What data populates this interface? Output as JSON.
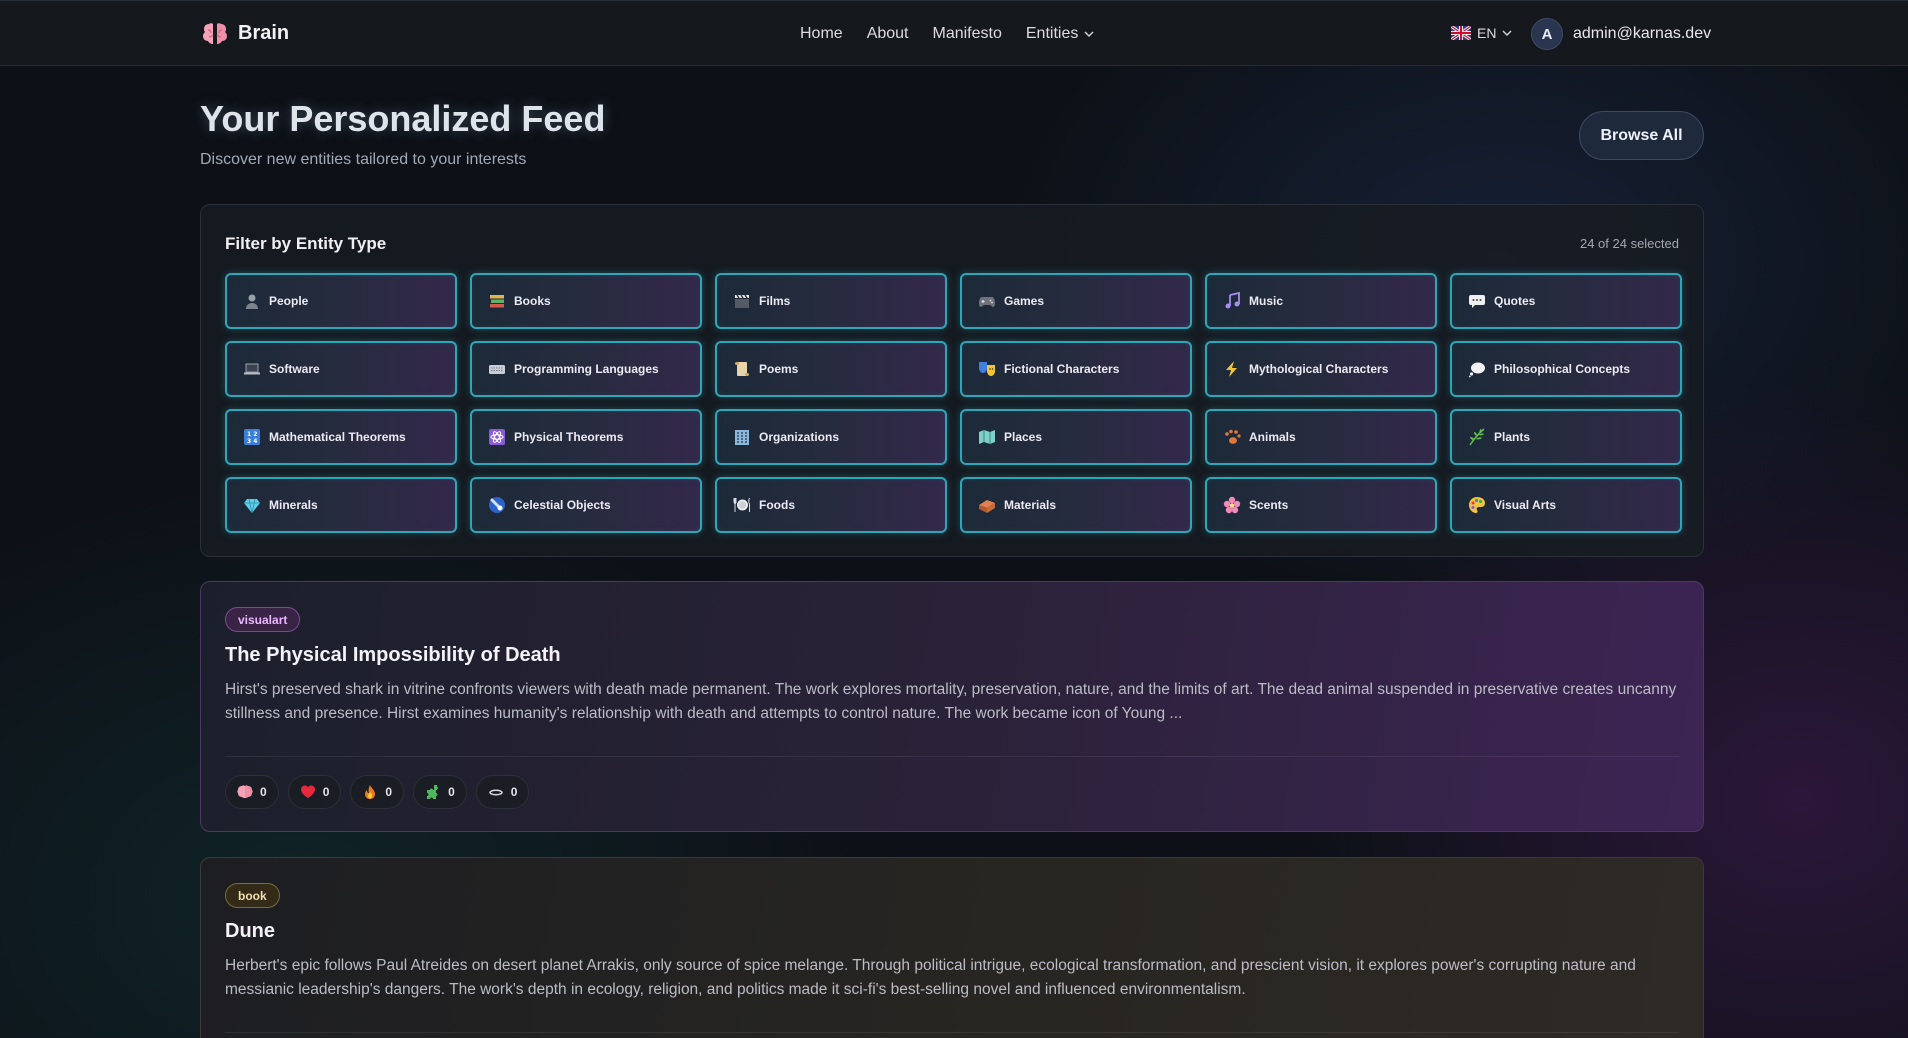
{
  "app": {
    "name": "Brain",
    "logo_icon": "brain-icon"
  },
  "nav": {
    "home": "Home",
    "about": "About",
    "manifesto": "Manifesto",
    "entities": "Entities"
  },
  "language": {
    "code": "EN",
    "flag_icon": "uk-flag-icon"
  },
  "user": {
    "avatar_letter": "A",
    "email": "admin@karnas.dev"
  },
  "page": {
    "title": "Your Personalized Feed",
    "subtitle": "Discover new entities tailored to your interests",
    "browse_all": "Browse All"
  },
  "filter": {
    "title": "Filter by Entity Type",
    "selected_count": "24 of 24 selected",
    "accent_color": "#2fa6b8",
    "types": [
      {
        "label": "People",
        "icon": "person-icon"
      },
      {
        "label": "Books",
        "icon": "books-icon"
      },
      {
        "label": "Films",
        "icon": "clapper-icon"
      },
      {
        "label": "Games",
        "icon": "gamepad-icon"
      },
      {
        "label": "Music",
        "icon": "music-note-icon"
      },
      {
        "label": "Quotes",
        "icon": "speech-bubble-icon"
      },
      {
        "label": "Software",
        "icon": "laptop-icon"
      },
      {
        "label": "Programming Languages",
        "icon": "keyboard-icon"
      },
      {
        "label": "Poems",
        "icon": "scroll-icon"
      },
      {
        "label": "Fictional Characters",
        "icon": "theater-masks-icon"
      },
      {
        "label": "Mythological Characters",
        "icon": "lightning-icon"
      },
      {
        "label": "Philosophical Concepts",
        "icon": "thought-bubble-icon"
      },
      {
        "label": "Mathematical Theorems",
        "icon": "numbers-icon"
      },
      {
        "label": "Physical Theorems",
        "icon": "atom-icon"
      },
      {
        "label": "Organizations",
        "icon": "building-icon"
      },
      {
        "label": "Places",
        "icon": "map-icon"
      },
      {
        "label": "Animals",
        "icon": "paw-icon"
      },
      {
        "label": "Plants",
        "icon": "herb-icon"
      },
      {
        "label": "Minerals",
        "icon": "gem-icon"
      },
      {
        "label": "Celestial Objects",
        "icon": "comet-icon"
      },
      {
        "label": "Foods",
        "icon": "plate-icon"
      },
      {
        "label": "Materials",
        "icon": "bricks-icon"
      },
      {
        "label": "Scents",
        "icon": "blossom-icon"
      },
      {
        "label": "Visual Arts",
        "icon": "palette-icon"
      }
    ]
  },
  "feed": [
    {
      "badge": "visualart",
      "title": "The Physical Impossibility of Death",
      "description": "Hirst's preserved shark in vitrine confronts viewers with death made permanent. The work explores mortality, preservation, nature, and the limits of art. The dead animal suspended in preservative creates uncanny stillness and presence. Hirst examines humanity's relationship with death and attempts to control nature. The work became icon of Young ...",
      "reactions": [
        {
          "icon": "brain-icon",
          "count": "0"
        },
        {
          "icon": "heart-icon",
          "count": "0"
        },
        {
          "icon": "fire-icon",
          "count": "0"
        },
        {
          "icon": "puzzle-icon",
          "count": "0"
        },
        {
          "icon": "meh-icon",
          "count": "0"
        }
      ]
    },
    {
      "badge": "book",
      "title": "Dune",
      "description": "Herbert's epic follows Paul Atreides on desert planet Arrakis, only source of spice melange. Through political intrigue, ecological transformation, and prescient vision, it explores power's corrupting nature and messianic leadership's dangers. The work's depth in ecology, religion, and politics made it sci-fi's best-selling novel and influenced environmentalism."
    }
  ]
}
